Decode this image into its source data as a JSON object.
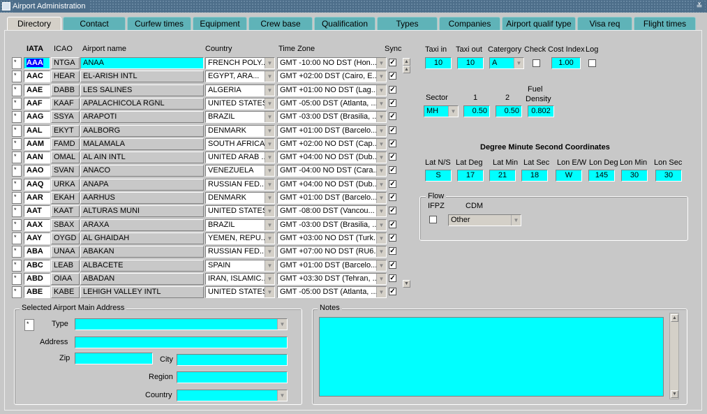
{
  "window": {
    "title": "Airport Administration",
    "close_glyph": "≚"
  },
  "tabs": [
    "Directory",
    "Contact",
    "Curfew times",
    "Equipment",
    "Crew base",
    "Qualification",
    "Types",
    "Companies",
    "Airport qualif type",
    "Visa req",
    "Flight times"
  ],
  "grid": {
    "headers": {
      "iata": "IATA",
      "icao": "ICAO",
      "name": "Airport name",
      "country": "Country",
      "tz": "Time Zone",
      "sync": "Sync"
    },
    "rows": [
      {
        "iata": "AAA",
        "icao": "NTGA",
        "name": "ANAA",
        "country": "FRENCH POLY...",
        "tz": "GMT -10:00 NO DST (Hon..."
      },
      {
        "iata": "AAC",
        "icao": "HEAR",
        "name": "EL-ARISH INTL",
        "country": "EGYPT,  ARA...",
        "tz": "GMT +02:00 DST (Cairo, E..."
      },
      {
        "iata": "AAE",
        "icao": "DABB",
        "name": "LES SALINES",
        "country": "ALGERIA",
        "tz": "GMT +01:00 NO DST (Lag..."
      },
      {
        "iata": "AAF",
        "icao": "KAAF",
        "name": "APALACHICOLA RGNL",
        "country": "UNITED STATES",
        "tz": "GMT -05:00 DST (Atlanta, ..."
      },
      {
        "iata": "AAG",
        "icao": "SSYA",
        "name": "ARAPOTI",
        "country": "BRAZIL",
        "tz": "GMT -03:00 DST (Brasilia, ..."
      },
      {
        "iata": "AAL",
        "icao": "EKYT",
        "name": "AALBORG",
        "country": "DENMARK",
        "tz": "GMT +01:00 DST (Barcelo..."
      },
      {
        "iata": "AAM",
        "icao": "FAMD",
        "name": "MALAMALA",
        "country": "SOUTH AFRICA",
        "tz": "GMT +02:00 NO DST (Cap..."
      },
      {
        "iata": "AAN",
        "icao": "OMAL",
        "name": "AL AIN INTL",
        "country": "UNITED ARAB ...",
        "tz": "GMT +04:00 NO DST (Dub..."
      },
      {
        "iata": "AAO",
        "icao": "SVAN",
        "name": "ANACO",
        "country": "VENEZUELA",
        "tz": "GMT -04:00 NO DST (Cara..."
      },
      {
        "iata": "AAQ",
        "icao": "URKA",
        "name": "ANAPA",
        "country": "RUSSIAN FED...",
        "tz": "GMT +04:00 NO DST (Dub..."
      },
      {
        "iata": "AAR",
        "icao": "EKAH",
        "name": "AARHUS",
        "country": "DENMARK",
        "tz": "GMT +01:00 DST (Barcelo..."
      },
      {
        "iata": "AAT",
        "icao": "KAAT",
        "name": "ALTURAS MUNI",
        "country": "UNITED STATES",
        "tz": "GMT -08:00 DST (Vancou..."
      },
      {
        "iata": "AAX",
        "icao": "SBAX",
        "name": "ARAXA",
        "country": "BRAZIL",
        "tz": "GMT -03:00 DST (Brasilia, ..."
      },
      {
        "iata": "AAY",
        "icao": "OYGD",
        "name": "AL GHAIDAH",
        "country": "YEMEN, REPU...",
        "tz": "GMT +03:00 NO DST (Turk..."
      },
      {
        "iata": "ABA",
        "icao": "UNAA",
        "name": "ABAKAN",
        "country": "RUSSIAN FED...",
        "tz": "GMT +07:00 NO DST (RU6..."
      },
      {
        "iata": "ABC",
        "icao": "LEAB",
        "name": "ALBACETE",
        "country": "SPAIN",
        "tz": "GMT +01:00 DST (Barcelo..."
      },
      {
        "iata": "ABD",
        "icao": "OIAA",
        "name": "ABADAN",
        "country": "IRAN, ISLAMIC...",
        "tz": "GMT +03:30 DST (Tehran, ..."
      },
      {
        "iata": "ABE",
        "icao": "KABE",
        "name": "LEHIGH VALLEY INTL",
        "country": "UNITED STATES",
        "tz": "GMT -05:00 DST (Atlanta, ..."
      }
    ]
  },
  "taxi": {
    "labels": {
      "taxi_in": "Taxi in",
      "taxi_out": "Taxi out",
      "category": "Catergory",
      "check": "Check",
      "cost_index": "Cost Index",
      "log": "Log"
    },
    "values": {
      "taxi_in": "10",
      "taxi_out": "10",
      "category": "A",
      "cost_index": "1.00"
    }
  },
  "sector": {
    "labels": {
      "sector": "Sector",
      "one": "1",
      "two": "2",
      "fuel": "Fuel",
      "density": "Density"
    },
    "values": {
      "sector": "MH",
      "one": "0.50",
      "two": "0.50",
      "density": "0.802"
    }
  },
  "coords": {
    "title": "Degree Minute Second Coordinates",
    "labels": [
      "Lat N/S",
      "Lat Deg",
      "Lat Min",
      "Lat Sec",
      "Lon E/W",
      "Lon Deg",
      "Lon Min",
      "Lon Sec"
    ],
    "values": [
      "S",
      "17",
      "21",
      "18",
      "W",
      "145",
      "30",
      "30"
    ]
  },
  "flow": {
    "title": "Flow",
    "ifpz": "IFPZ",
    "cdm": "CDM",
    "cdm_value": "Other"
  },
  "address": {
    "title": "Selected Airport Main Address",
    "type": "Type",
    "address": "Address",
    "zip": "Zip",
    "city": "City",
    "region": "Region",
    "country": "Country"
  },
  "notes": {
    "title": "Notes"
  },
  "colors": {
    "field": "#00ffff",
    "tab": "#5fb3b8",
    "selected": "#0000ff"
  }
}
